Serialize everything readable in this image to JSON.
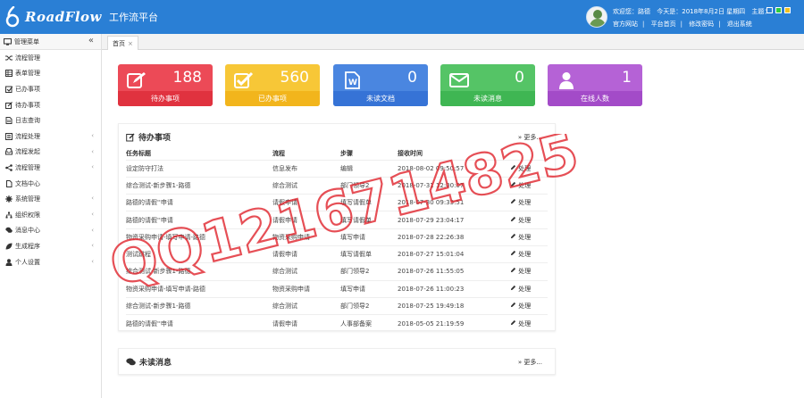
{
  "header": {
    "logo_text": "RoadFlow",
    "subtitle": "工作流平台",
    "greeting": "欢迎您：路德",
    "today": "今天是：2018年8月2日 星期四",
    "theme_label": "主题：",
    "links": [
      "官方网站",
      "平台首页",
      "修改密码",
      "退出系统"
    ],
    "theme_colors": [
      "#ffffff",
      "#2ecc40",
      "#f0c020"
    ]
  },
  "sidebar": {
    "title": "管理菜单",
    "collapse_icon": "«",
    "items": [
      {
        "label": "流程管理",
        "icon": "shuffle-icon",
        "arrow": false
      },
      {
        "label": "表单管理",
        "icon": "table-icon",
        "arrow": false
      },
      {
        "label": "已办事项",
        "icon": "checkbox-icon",
        "arrow": false
      },
      {
        "label": "待办事项",
        "icon": "edit-icon",
        "arrow": false
      },
      {
        "label": "日志查询",
        "icon": "file-icon",
        "arrow": false
      },
      {
        "label": "流程处理",
        "icon": "list-icon",
        "arrow": true
      },
      {
        "label": "流程发起",
        "icon": "inbox-icon",
        "arrow": true
      },
      {
        "label": "流程管理",
        "icon": "share-icon",
        "arrow": true
      },
      {
        "label": "文档中心",
        "icon": "doc-icon",
        "arrow": false
      },
      {
        "label": "系统管理",
        "icon": "gear-icon",
        "arrow": true
      },
      {
        "label": "组织权限",
        "icon": "sitemap-icon",
        "arrow": true
      },
      {
        "label": "消息中心",
        "icon": "comments-icon",
        "arrow": true
      },
      {
        "label": "生成程序",
        "icon": "leaf-icon",
        "arrow": true
      },
      {
        "label": "个人设置",
        "icon": "user-icon",
        "arrow": true
      }
    ]
  },
  "tabs": [
    {
      "label": "首页",
      "close": "×"
    }
  ],
  "cards": [
    {
      "label": "待办事项",
      "value": "188",
      "color": "#ec4a57",
      "band": "#e0323f",
      "icon": "edit-icon"
    },
    {
      "label": "已办事项",
      "value": "560",
      "color": "#f7c737",
      "band": "#f2b51c",
      "icon": "checkbox-icon"
    },
    {
      "label": "未读文档",
      "value": "0",
      "color": "#4a86e0",
      "band": "#3673d6",
      "icon": "word-icon"
    },
    {
      "label": "未读消息",
      "value": "0",
      "color": "#55c466",
      "band": "#3fb653",
      "icon": "envelope-icon"
    },
    {
      "label": "在线人数",
      "value": "1",
      "color": "#b562d6",
      "band": "#a34bc8",
      "icon": "user-icon"
    }
  ],
  "todo": {
    "title": "待办事项",
    "more": "» 更多...",
    "columns": [
      "任务标题",
      "流程",
      "步骤",
      "接收时间",
      ""
    ],
    "action": "处理",
    "rows": [
      {
        "title": "设定防守打法",
        "flow": "信息发布",
        "step": "编辑",
        "time": "2018-08-02 09:50:57"
      },
      {
        "title": "综合测试-新步骤1-路德",
        "flow": "综合测试",
        "step": "部门领导2",
        "time": "2018-07-31 12:00:07"
      },
      {
        "title": "路德的请假''申请",
        "flow": "请假申请",
        "step": "填写请假单",
        "time": "2018-07-30 09:33:51"
      },
      {
        "title": "路德的请假''申请",
        "flow": "请假申请",
        "step": "填写请假单",
        "time": "2018-07-29 23:04:17"
      },
      {
        "title": "物资采购申请-填写申请-路德",
        "flow": "物资采购申请",
        "step": "填写申请",
        "time": "2018-07-28 22:26:38"
      },
      {
        "title": "测试跳程",
        "flow": "请假申请",
        "step": "填写请假单",
        "time": "2018-07-27 15:01:04"
      },
      {
        "title": "综合测试-新步骤1-路德",
        "flow": "综合测试",
        "step": "部门领导2",
        "time": "2018-07-26 11:55:05"
      },
      {
        "title": "物资采购申请-填写申请-路德",
        "flow": "物资采购申请",
        "step": "填写申请",
        "time": "2018-07-26 11:00:23"
      },
      {
        "title": "综合测试-新步骤1-路德",
        "flow": "综合测试",
        "step": "部门领导2",
        "time": "2018-07-25 19:49:18"
      },
      {
        "title": "路德的请假''申请",
        "flow": "请假申请",
        "step": "人事部备案",
        "time": "2018-05-05 21:19:59"
      }
    ]
  },
  "unread": {
    "title": "未读消息",
    "more": "» 更多..."
  },
  "watermark": {
    "text": "QQ1216714825",
    "color": "#e0242c"
  }
}
